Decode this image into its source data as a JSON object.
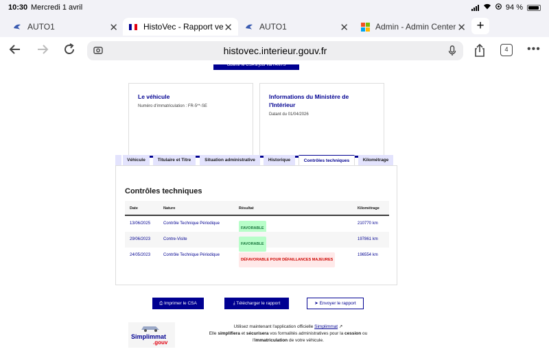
{
  "status": {
    "time": "10:30",
    "date": "Mercredi 1 avril",
    "battery": "94 %"
  },
  "tabs": [
    {
      "title": "AUTO1",
      "active": false
    },
    {
      "title": "HistoVec - Rapport vendeur",
      "active": true
    },
    {
      "title": "AUTO1",
      "active": false
    },
    {
      "title": "Admin - Admin Center",
      "active": false
    }
  ],
  "toolbar": {
    "url": "histovec.interieur.gouv.fr",
    "tab_count": "4"
  },
  "page": {
    "csa_top_button": "Obtenir le CSA à jour via l'ANTS",
    "vehicle_card": {
      "title": "Le véhicule",
      "plate": "Numéro d'immatriculation : FR-5**-SE"
    },
    "ministry_card": {
      "title": "Informations du Ministère de l'Intérieur",
      "date": "Datant du 01/04/2026"
    },
    "section_tabs": [
      "Véhicule",
      "Titulaire et Titre",
      "Situation administrative",
      "Historique",
      "Contrôles techniques",
      "Kilométrage"
    ],
    "selected_tab": "Contrôles techniques",
    "panel_title": "Contrôles techniques",
    "table": {
      "headers": [
        "Date",
        "Nature",
        "Résultat",
        "Kilométrage"
      ],
      "rows": [
        {
          "date": "13/06/2025",
          "nature": "Contrôle Technique Périodique",
          "result": "FAVORABLE",
          "status": "ok",
          "km": "210770 km"
        },
        {
          "date": "29/06/2023",
          "nature": "Contre-Visite",
          "result": "FAVORABLE",
          "status": "ok",
          "km": "197861 km"
        },
        {
          "date": "24/05/2023",
          "nature": "Contrôle Technique Périodique",
          "result": "DÉFAVORABLE POUR DÉFAILLANCES MAJEURES",
          "status": "ko",
          "km": "196554 km"
        }
      ]
    },
    "actions": {
      "print": "Imprimer le CSA",
      "download": "Télécharger le rapport",
      "send": "Envoyer le rapport"
    },
    "promo": {
      "logo_word": "Simplimmat",
      "logo_suffix": ".gouv",
      "line1_before": "Utilisez maintenant l'application officielle",
      "link": "Simplimmat",
      "line2_a": "Elle",
      "simplifiera": "simplifiera",
      "line2_b": "et",
      "securisera": "sécurisera",
      "line2_c": "vos formalités administratives pour la",
      "cession": "cession",
      "line2_d": "ou",
      "line3_a": "l'",
      "immatriculation": "immatriculation",
      "line3_b": "de votre véhicule."
    }
  }
}
